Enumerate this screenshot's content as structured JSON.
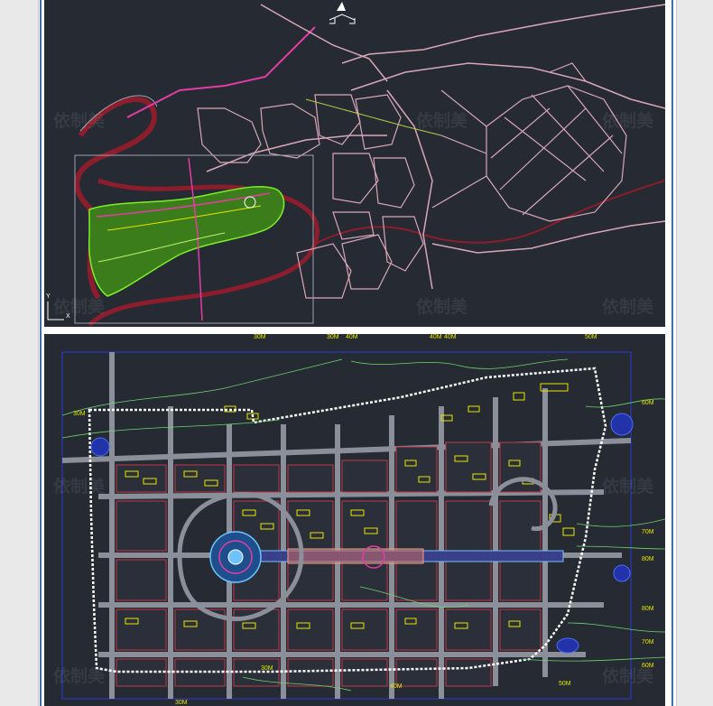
{
  "top_panel": {
    "axis_y": "Y",
    "axis_x": "X",
    "watermarks": [
      "依制美",
      "依制美",
      "依制美",
      "依制美",
      "依制美",
      "依制美"
    ]
  },
  "bottom_panel": {
    "top_labels": [
      "30M",
      "30M",
      "40M",
      "40M",
      "40M",
      "50M"
    ],
    "right_labels": [
      "60M",
      "70M",
      "80M",
      "80M",
      "70M",
      "60M"
    ],
    "left_labels": [
      "30M"
    ],
    "bottom_labels": [
      "30M",
      "40M",
      "50M",
      "30M"
    ],
    "watermarks": [
      "依制美",
      "依制美",
      "依制美",
      "依制美"
    ]
  },
  "colors": {
    "cad_background": "#252a33",
    "road": "#d9a6b8",
    "road_major": "#e23ca5",
    "river": "#8b1d2c",
    "vegetation": "#7cf02a",
    "boundary": "#ffffff",
    "label": "#e6e600"
  }
}
